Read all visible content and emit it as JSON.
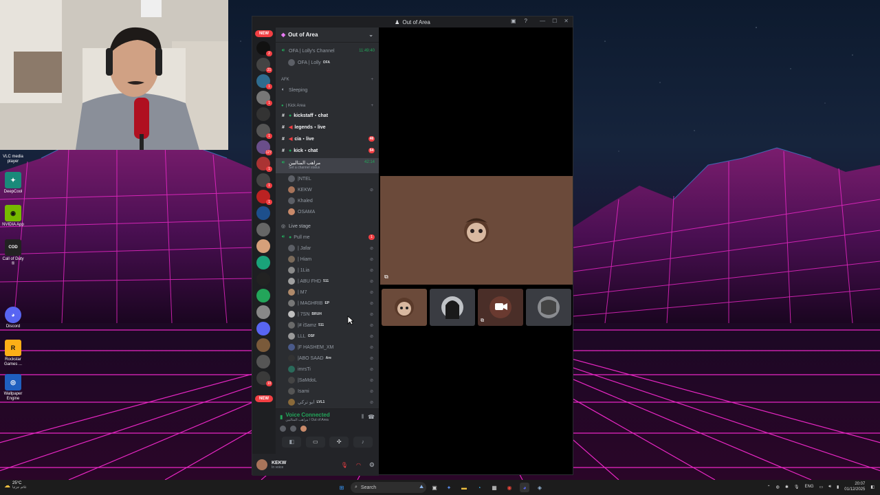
{
  "desktop": {
    "icons": [
      {
        "name": "vlc-icon",
        "label": "VLC media player",
        "color": "#ff8800"
      },
      {
        "name": "deepcool-icon",
        "label": "DeepCool",
        "color": "#1a8a7a"
      },
      {
        "name": "nvidia-icon",
        "label": "NVIDIA App",
        "color": "#76b900"
      },
      {
        "name": "cod-icon",
        "label": "Call of Duty ®",
        "color": "#222222"
      },
      {
        "name": "discord-desktop-icon",
        "label": "Discord",
        "color": "#5865f2"
      },
      {
        "name": "rockstar-icon",
        "label": "Rockstar Games ...",
        "color": "#fcaf17"
      },
      {
        "name": "wallpaper-engine-icon",
        "label": "Wallpaper Engine",
        "color": "#1f5fbf"
      }
    ]
  },
  "window": {
    "title": "Out of Area"
  },
  "guilds": {
    "new_top": "NEW",
    "new_bottom": "NEW",
    "badges": [
      "2",
      "21",
      "1",
      "1",
      "",
      "1",
      "127",
      "1",
      "1",
      "1",
      "1",
      "",
      "",
      "",
      "",
      "",
      "",
      "",
      "",
      "10",
      "",
      ""
    ]
  },
  "sidebar": {
    "server_name": "Out of Area",
    "ofa_channel": "OFA | Lolly's Channel",
    "ofa_time": "11:49:40",
    "ofa_member": "OFA | Lolly",
    "ofa_member_tag": "OFA",
    "afk_category": "AFK",
    "sleeping": "Sleeping",
    "kick_category": "| Kick Area",
    "channels": [
      {
        "label": "kickstaff・chat",
        "pill": ""
      },
      {
        "label": "legends・live",
        "pill": ""
      },
      {
        "label": "cia・live",
        "pill": "46"
      },
      {
        "label": "kick・chat",
        "pill": "54"
      }
    ],
    "current_voice": "مراهب المتالبين",
    "current_voice_time": "42:14",
    "current_status": "Set a channel status",
    "current_members": [
      "|NTEL",
      "KEKW",
      "Khaled",
      "OSAMA"
    ],
    "stage_category": "Live stage",
    "pull_me": "Pull me",
    "pull_me_pill": "1",
    "stage_members": [
      {
        "name": "| Jafar",
        "tag": ""
      },
      {
        "name": "| Hiam",
        "tag": ""
      },
      {
        "name": "| 1Lia",
        "tag": ""
      },
      {
        "name": "| ABU FHD",
        "tag": "511"
      },
      {
        "name": "| M7",
        "tag": ""
      },
      {
        "name": "| MAGHRIB",
        "tag": "EP"
      },
      {
        "name": "| 7SN",
        "tag": "BRUH"
      },
      {
        "name": "|# iSamz",
        "tag": "511"
      },
      {
        "name": "LLL",
        "tag": "OSF"
      },
      {
        "name": "|F HASHEM_XM",
        "tag": ""
      },
      {
        "name": "|ABO SAAD",
        "tag": "Are"
      },
      {
        "name": "imrsTi",
        "tag": ""
      },
      {
        "name": "|SaMdoL",
        "tag": ""
      },
      {
        "name": "Isami",
        "tag": ""
      },
      {
        "name": "ابو تركي",
        "tag": "LVL1"
      }
    ]
  },
  "voice": {
    "status": "Voice Connected",
    "location": "مراهب المتالبين / Out of Area"
  },
  "user": {
    "name": "KEKW",
    "status": "In voice"
  },
  "taskbar": {
    "weather_temp": "25°C",
    "weather_desc": "غائم جزئيا",
    "search_placeholder": "Search",
    "lang": "ENG",
    "time": "20:07",
    "date": "01/12/2025"
  },
  "colors": {
    "discord_bg": "#1e1f22",
    "sidebar_bg": "#2b2d31",
    "accent_green": "#23a55a",
    "badge_red": "#f23f43",
    "blurple": "#5865f2",
    "grid_pink": "#ff2bd6",
    "grid_blue": "#3aa8ff"
  }
}
